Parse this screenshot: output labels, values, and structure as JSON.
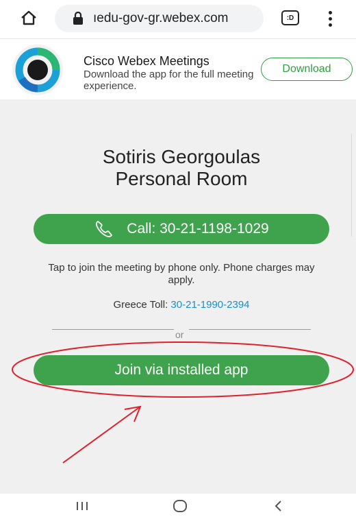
{
  "browser": {
    "url": "ıedu-gov-gr.webex.com",
    "tab_count": ":D",
    "icons": [
      "home-icon",
      "lock-icon",
      "tabs-icon",
      "more-vert-icon"
    ]
  },
  "app_banner": {
    "title": "Cisco Webex Meetings",
    "subtitle": "Download the app for the full meeting experience.",
    "download_label": "Download"
  },
  "meeting": {
    "title_line1": "Sotiris Georgoulas",
    "title_line2": "Personal Room",
    "call_label": "Call: 30-21-1198-1029",
    "phone_note": "Tap to join the meeting by phone only. Phone charges may apply.",
    "toll_label": "Greece Toll: ",
    "toll_number": "30-21-1990-2394",
    "or_text": "or",
    "join_label": "Join via installed app"
  },
  "colors": {
    "brand_green": "#3fa34d",
    "link_blue": "#1a8fc9",
    "annotation_red": "#e0202a"
  },
  "nav_bar": {
    "buttons": [
      "recents-icon",
      "home-circle-icon",
      "back-icon"
    ]
  }
}
